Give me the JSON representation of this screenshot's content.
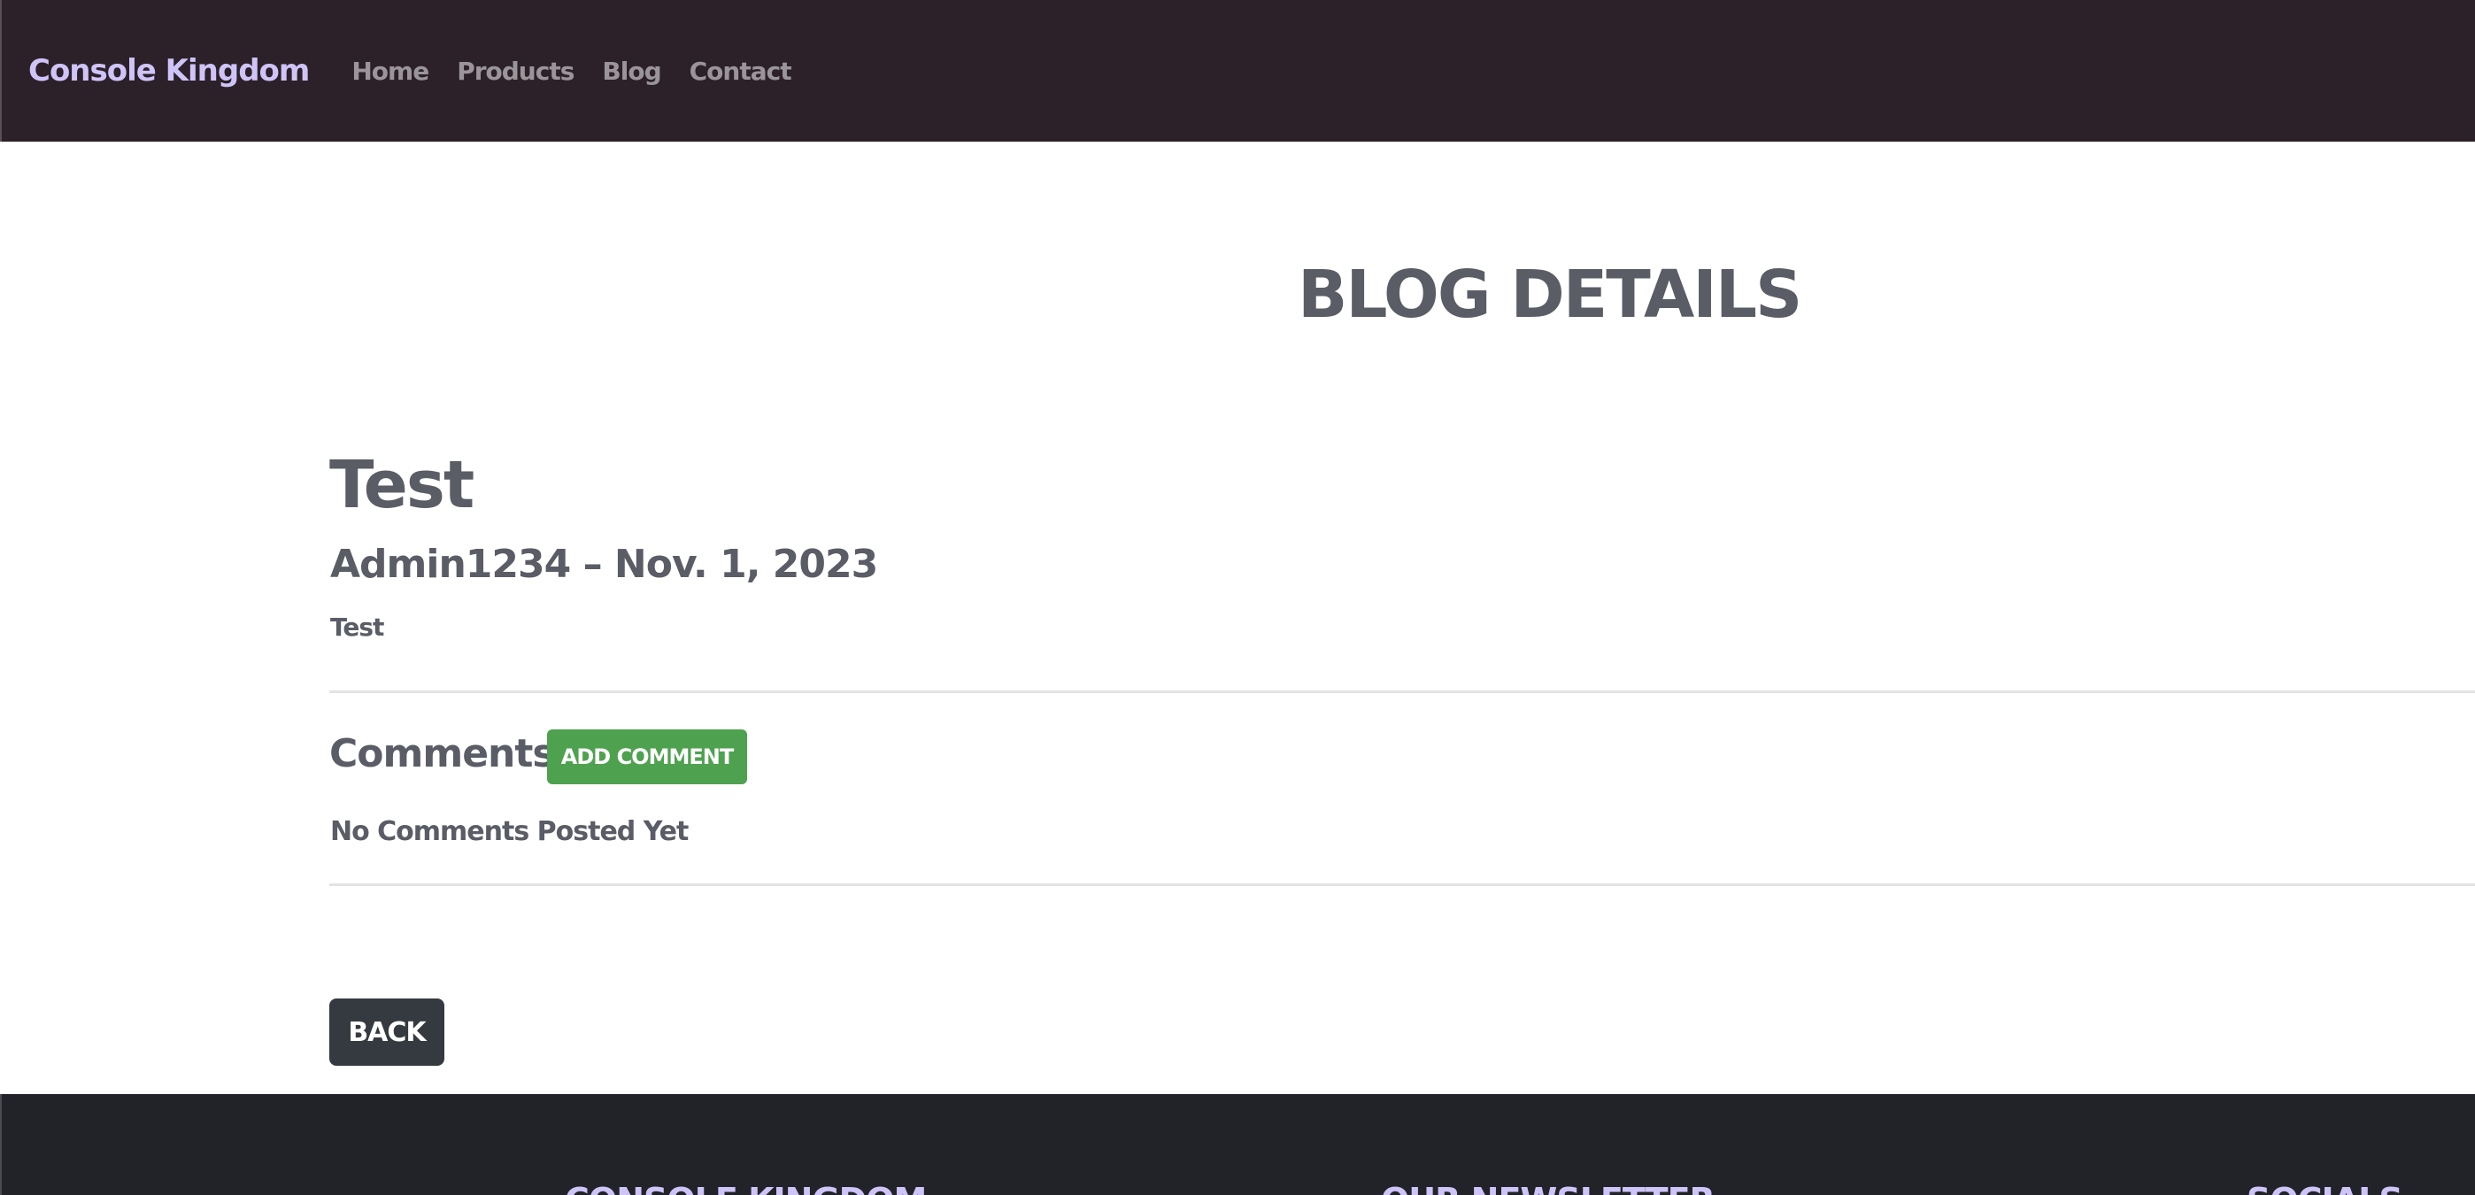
{
  "navbar": {
    "brand": "Console Kingdom",
    "links": [
      "Home",
      "Products",
      "Blog",
      "Contact"
    ]
  },
  "page": {
    "heading": "BLOG DETAILS"
  },
  "post": {
    "title": "Test",
    "meta": "Admin1234 – Nov. 1, 2023",
    "body": "Test"
  },
  "comments": {
    "heading": "Comments:",
    "add_label": "ADD COMMENT",
    "empty_text": "No Comments Posted Yet"
  },
  "actions": {
    "back_label": "BACK"
  },
  "footer": {
    "columns": [
      "CONSOLE KINGDOM",
      "OUR NEWSLETTER",
      "SOCIALS"
    ]
  },
  "colors": {
    "navbar_bg": "#2c2029",
    "brand": "#cfc4f7",
    "add_button": "#4ea24f",
    "back_button": "#343a40",
    "footer_bg": "#222328"
  }
}
